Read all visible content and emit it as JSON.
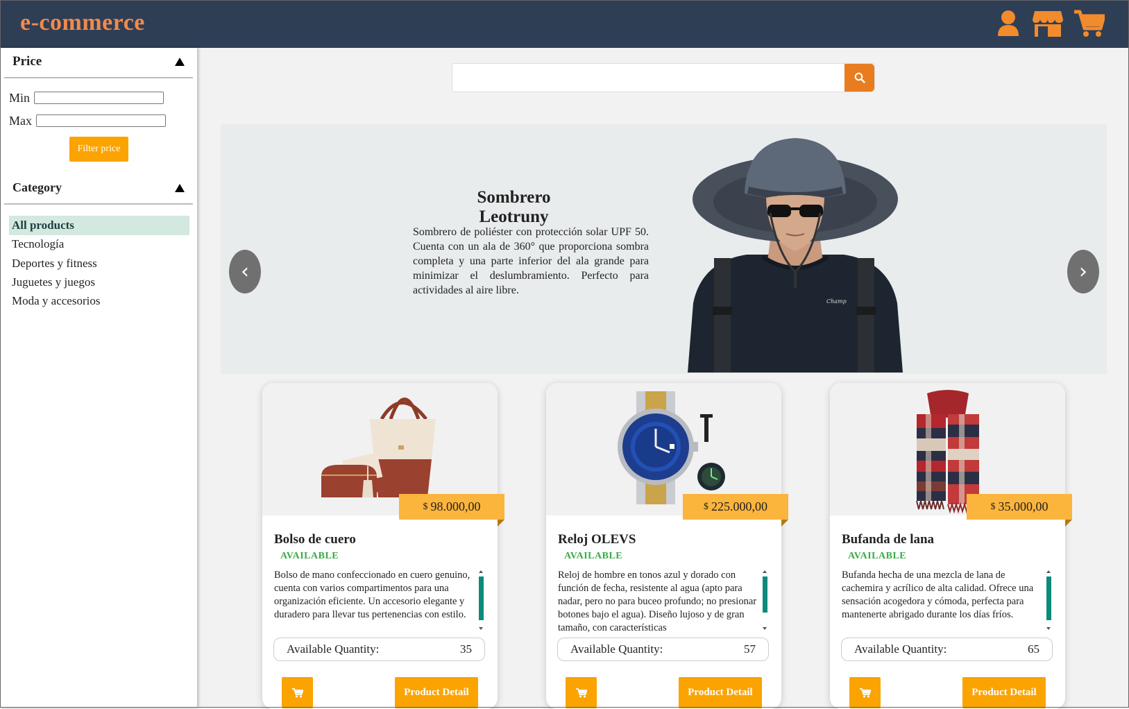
{
  "header": {
    "brand": "e-commerce",
    "icons": [
      "user-icon",
      "store-icon",
      "cart-icon"
    ],
    "bg_color": "#2e3e55",
    "brand_color": "#f08a4b",
    "icon_color": "#f28b2c"
  },
  "sidebar": {
    "price": {
      "heading": "Price",
      "min_label": "Min",
      "max_label": "Max",
      "min_value": "",
      "max_value": "",
      "filter_label": "Filter price"
    },
    "category": {
      "heading": "Category",
      "items": [
        {
          "label": "All products",
          "active": true
        },
        {
          "label": "Tecnología",
          "active": false
        },
        {
          "label": "Deportes y fitness",
          "active": false
        },
        {
          "label": "Juguetes y juegos",
          "active": false
        },
        {
          "label": "Moda y accesorios",
          "active": false
        }
      ]
    }
  },
  "search": {
    "value": "",
    "placeholder": "",
    "button_icon": "search-icon"
  },
  "banner": {
    "title": "Sombrero Leotruny",
    "description": "Sombrero de poliéster con protección solar UPF 50. Cuenta con un ala de 360° que proporciona sombra completa y una parte inferior del ala grande para minimizar el deslumbramiento. Perfecto para actividades al aire libre.",
    "prev_icon": "‹",
    "next_icon": "›"
  },
  "products": [
    {
      "currency": "$",
      "price": "98.000,00",
      "name": "Bolso de cuero",
      "status": "AVAILABLE",
      "description": "Bolso de mano confeccionado en cuero genuino, cuenta con varios compartimentos para una organización eficiente. Un accesorio elegante y duradero para llevar tus pertenencias con estilo.",
      "qty_label": "Available Quantity:",
      "qty": "35",
      "detail_label": "Product Detail"
    },
    {
      "currency": "$",
      "price": "225.000,00",
      "name": "Reloj OLEVS",
      "status": "AVAILABLE",
      "description": "Reloj de hombre en tonos azul y dorado con función de fecha, resistente al agua (apto para nadar, pero no para buceo profundo; no presionar botones bajo el agua). Diseño lujoso y de gran tamaño, con características",
      "qty_label": "Available Quantity:",
      "qty": "57",
      "detail_label": "Product Detail"
    },
    {
      "currency": "$",
      "price": "35.000,00",
      "name": "Bufanda de lana",
      "status": "AVAILABLE",
      "description": "Bufanda hecha de una mezcla de lana de cachemira y acrílico de alta calidad. Ofrece una sensación acogedora y cómoda, perfecta para mantenerte abrigado durante los días fríos.",
      "qty_label": "Available Quantity:",
      "qty": "65",
      "detail_label": "Product Detail"
    }
  ],
  "colors": {
    "accent": "#fba300",
    "price_tag": "#fbb43c",
    "available": "#3aaa47",
    "active_category": "#d3e8df"
  }
}
